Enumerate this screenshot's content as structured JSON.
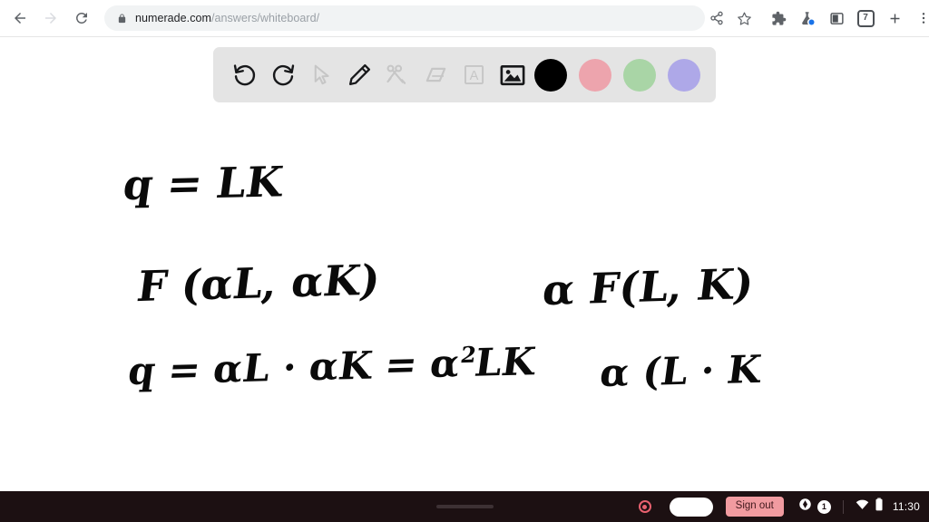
{
  "browser": {
    "back_label": "Back",
    "forward_label": "Forward",
    "reload_label": "Reload",
    "lock_icon": "lock-icon",
    "url_host": "numerade.com",
    "url_path": "/answers/whiteboard/",
    "omnibox_icons": [
      {
        "name": "share-icon",
        "label": "Share"
      },
      {
        "name": "bookmark-star-icon",
        "label": "Bookmark this tab"
      }
    ],
    "toolbar_icons": [
      {
        "name": "extensions-puzzle-icon",
        "label": "Extensions"
      },
      {
        "name": "experiments-flask-icon",
        "label": "Experiments"
      },
      {
        "name": "side-panel-icon",
        "label": "Side panel"
      }
    ],
    "tab_count": "7",
    "new_tab_label": "New tab",
    "menu_label": "Customize and control Chrome"
  },
  "whiteboard": {
    "toolbar": [
      {
        "name": "undo-icon",
        "label": "Undo",
        "state": "enabled"
      },
      {
        "name": "redo-icon",
        "label": "Redo",
        "state": "enabled"
      },
      {
        "name": "select-cursor-icon",
        "label": "Select",
        "state": "disabled"
      },
      {
        "name": "pen-icon",
        "label": "Pen",
        "state": "active"
      },
      {
        "name": "shapes-tools-icon",
        "label": "Shapes",
        "state": "disabled"
      },
      {
        "name": "eraser-icon",
        "label": "Eraser",
        "state": "disabled"
      },
      {
        "name": "text-icon",
        "label": "Text",
        "state": "disabled"
      },
      {
        "name": "image-icon",
        "label": "Image",
        "state": "enabled"
      }
    ],
    "colors": [
      {
        "name": "color-swatch-black",
        "label": "Black",
        "hex": "#000000",
        "selected": true
      },
      {
        "name": "color-swatch-pink",
        "label": "Pink",
        "hex": "#eda4ad",
        "selected": false
      },
      {
        "name": "color-swatch-green",
        "label": "Green",
        "hex": "#a9d5a6",
        "selected": false
      },
      {
        "name": "color-swatch-purple",
        "label": "Purple",
        "hex": "#aea8e8",
        "selected": false
      }
    ],
    "toolbar_bg": "#e4e4e4",
    "canvas_bg": "#ffffff",
    "ink_color": "#0a0a0a",
    "handwriting": {
      "line1": "q = LK",
      "line2": "F (αL, αK)",
      "line3": "α F(L, K)",
      "line4_a": "q = αL · αK = α",
      "line4_sup": "2",
      "line4_b": "LK",
      "line5": "α (L · K"
    }
  },
  "shelf": {
    "background": "#1c1012",
    "gesture_bar": "drag-handle",
    "recording_indicator": "screen-record-icon",
    "pill_indicator": "status-pill",
    "sign_out_label": "Sign out",
    "sign_out_bg": "#f19ba0",
    "status": {
      "shield_icon": "shield-icon",
      "notification_count": "1",
      "wifi_icon": "wifi-icon",
      "battery_icon": "battery-icon",
      "time": "11:30"
    }
  }
}
